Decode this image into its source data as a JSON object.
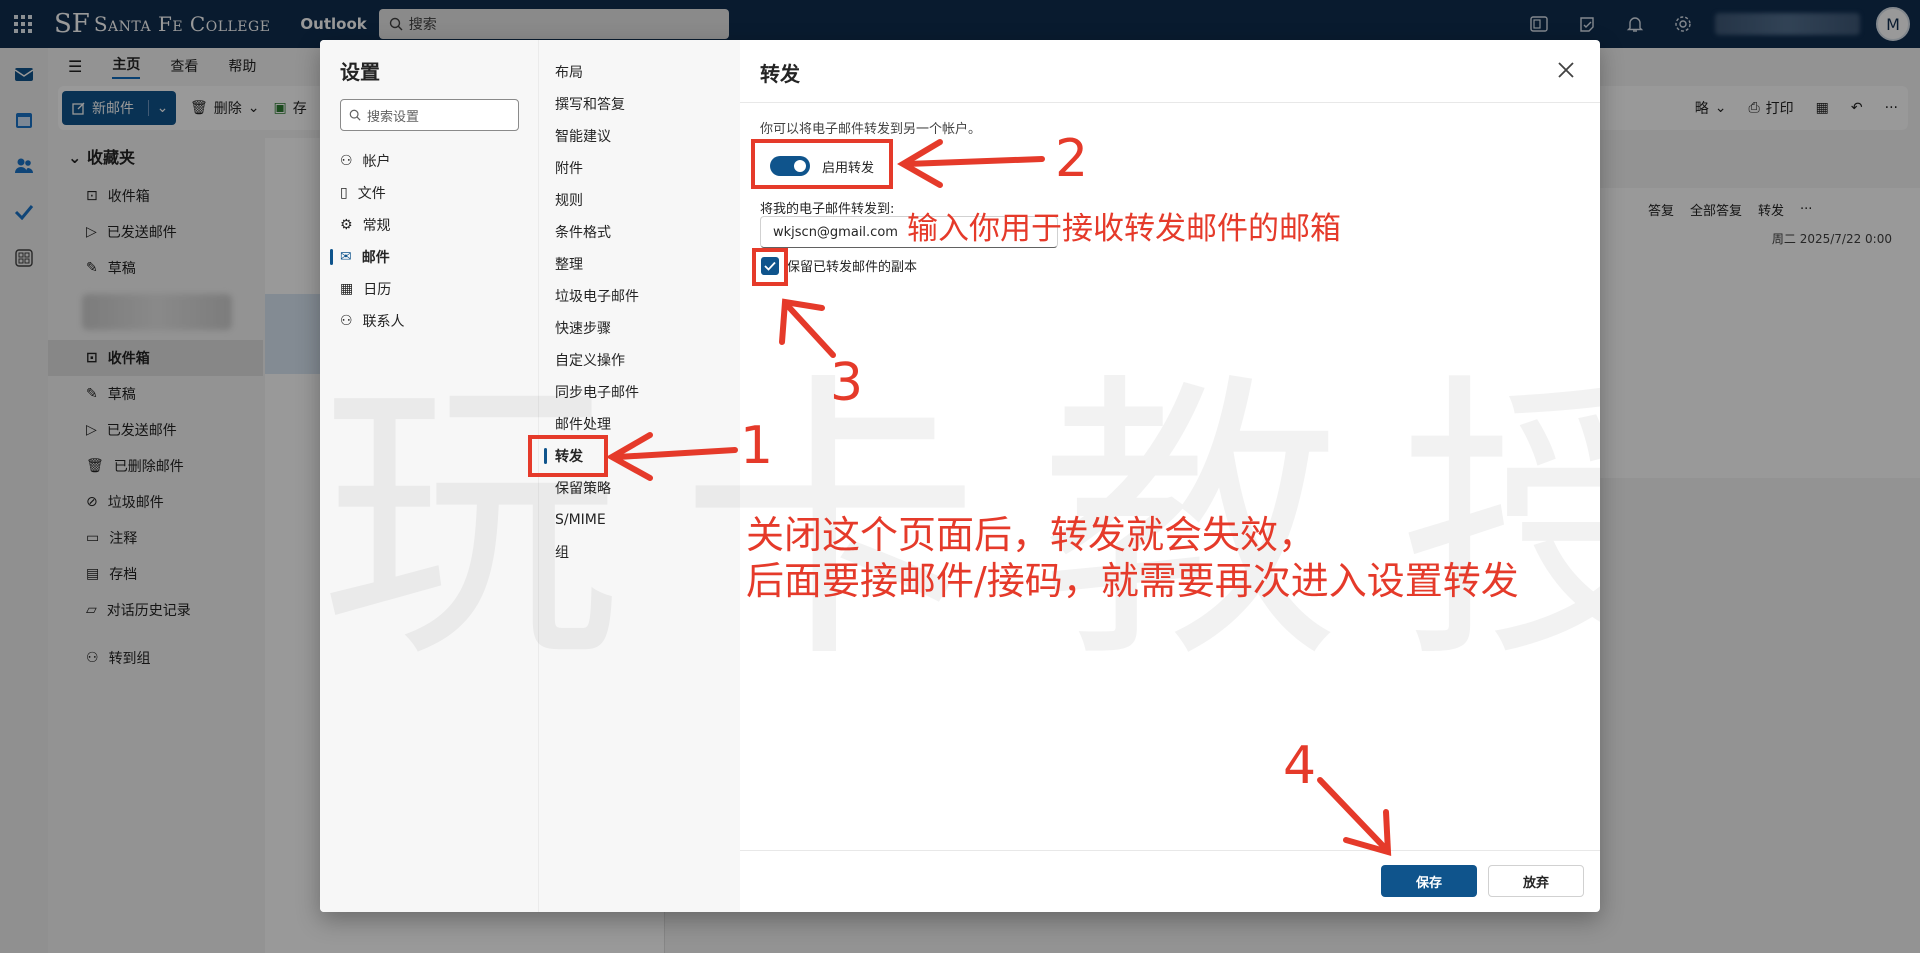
{
  "topbar": {
    "brand_mark": "SF",
    "brand_name": "Santa Fe College",
    "app_name": "Outlook",
    "search_placeholder": "搜索",
    "avatar_initial": "M"
  },
  "ribbon": {
    "tabs": [
      "主页",
      "查看",
      "帮助"
    ],
    "new_mail": "新邮件",
    "delete": "删除",
    "archive": "存",
    "strategy": "略",
    "print": "打印"
  },
  "folders": {
    "favorites_title": "收藏夹",
    "favorites": [
      "收件箱",
      "已发送邮件",
      "草稿"
    ],
    "account_items": [
      "收件箱",
      "草稿",
      "已发送邮件",
      "已删除邮件",
      "垃圾邮件",
      "注释",
      "存档",
      "对话历史记录"
    ],
    "go_to_groups": "转到组"
  },
  "reading_pane": {
    "reply": "答复",
    "reply_all": "全部答复",
    "forward": "转发",
    "date": "周二 2025/7/22 0:00"
  },
  "settings": {
    "title": "设置",
    "search_placeholder": "搜索设置",
    "categories": [
      "帐户",
      "文件",
      "常规",
      "邮件",
      "日历",
      "联系人"
    ],
    "selected_category": "邮件",
    "mail_sections": [
      "布局",
      "撰写和答复",
      "智能建议",
      "附件",
      "规则",
      "条件格式",
      "整理",
      "垃圾电子邮件",
      "快速步骤",
      "自定义操作",
      "同步电子邮件",
      "邮件处理",
      "转发",
      "保留策略",
      "S/MIME",
      "组"
    ],
    "selected_section": "转发"
  },
  "forwarding": {
    "title": "转发",
    "description": "你可以将电子邮件转发到另一个帐户。",
    "enable_label": "启用转发",
    "enabled": true,
    "forward_to_label": "将我的电子邮件转发到:",
    "forward_to_value": "wkjscn@gmail.com",
    "keep_copy_label": "保留已转发邮件的副本",
    "keep_copy": true,
    "save": "保存",
    "discard": "放弃"
  },
  "annotations": {
    "step1": "1",
    "step2": "2",
    "step3": "3",
    "step4": "4",
    "email_hint": "输入你用于接收转发邮件的邮箱",
    "note_line1": "关闭这个页面后，转发就会失效，",
    "note_line2": "后面要接邮件/接码，就需要再次进入设置转发",
    "watermark": "玩卡教授"
  },
  "colors": {
    "topbar": "#0f2d4f",
    "accent": "#0f548c",
    "annotation": "#e53a2a"
  }
}
